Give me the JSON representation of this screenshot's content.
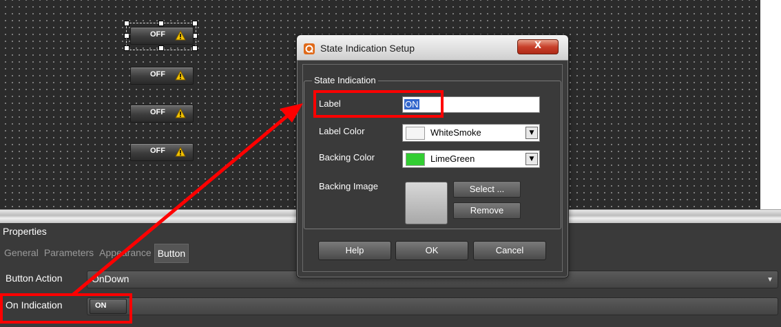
{
  "canvas": {
    "buttons": [
      {
        "label": "OFF",
        "icon": "warning-icon"
      },
      {
        "label": "OFF",
        "icon": "warning-icon"
      },
      {
        "label": "OFF",
        "icon": "warning-icon"
      },
      {
        "label": "OFF",
        "icon": "warning-icon"
      }
    ]
  },
  "properties": {
    "title": "Properties",
    "tabs": [
      "General",
      "Parameters",
      "Appearance",
      "Button"
    ],
    "active_tab": "Button",
    "button_action_label": "Button Action",
    "button_action_value": "OnDown",
    "on_indication_label": "On Indication",
    "on_indication_value": "ON"
  },
  "dialog": {
    "title": "State Indication Setup",
    "close_label": "X",
    "group_title": "State Indication",
    "label_label": "Label",
    "label_value": "ON",
    "label_color_label": "Label Color",
    "label_color_value": "WhiteSmoke",
    "label_color_hex": "#f5f5f5",
    "backing_color_label": "Backing Color",
    "backing_color_value": "LimeGreen",
    "backing_color_hex": "#32cd32",
    "backing_image_label": "Backing Image",
    "select_label": "Select ...",
    "remove_label": "Remove",
    "help_label": "Help",
    "ok_label": "OK",
    "cancel_label": "Cancel"
  },
  "colors": {
    "highlight": "#ff0000",
    "warning": "#f2c200"
  }
}
